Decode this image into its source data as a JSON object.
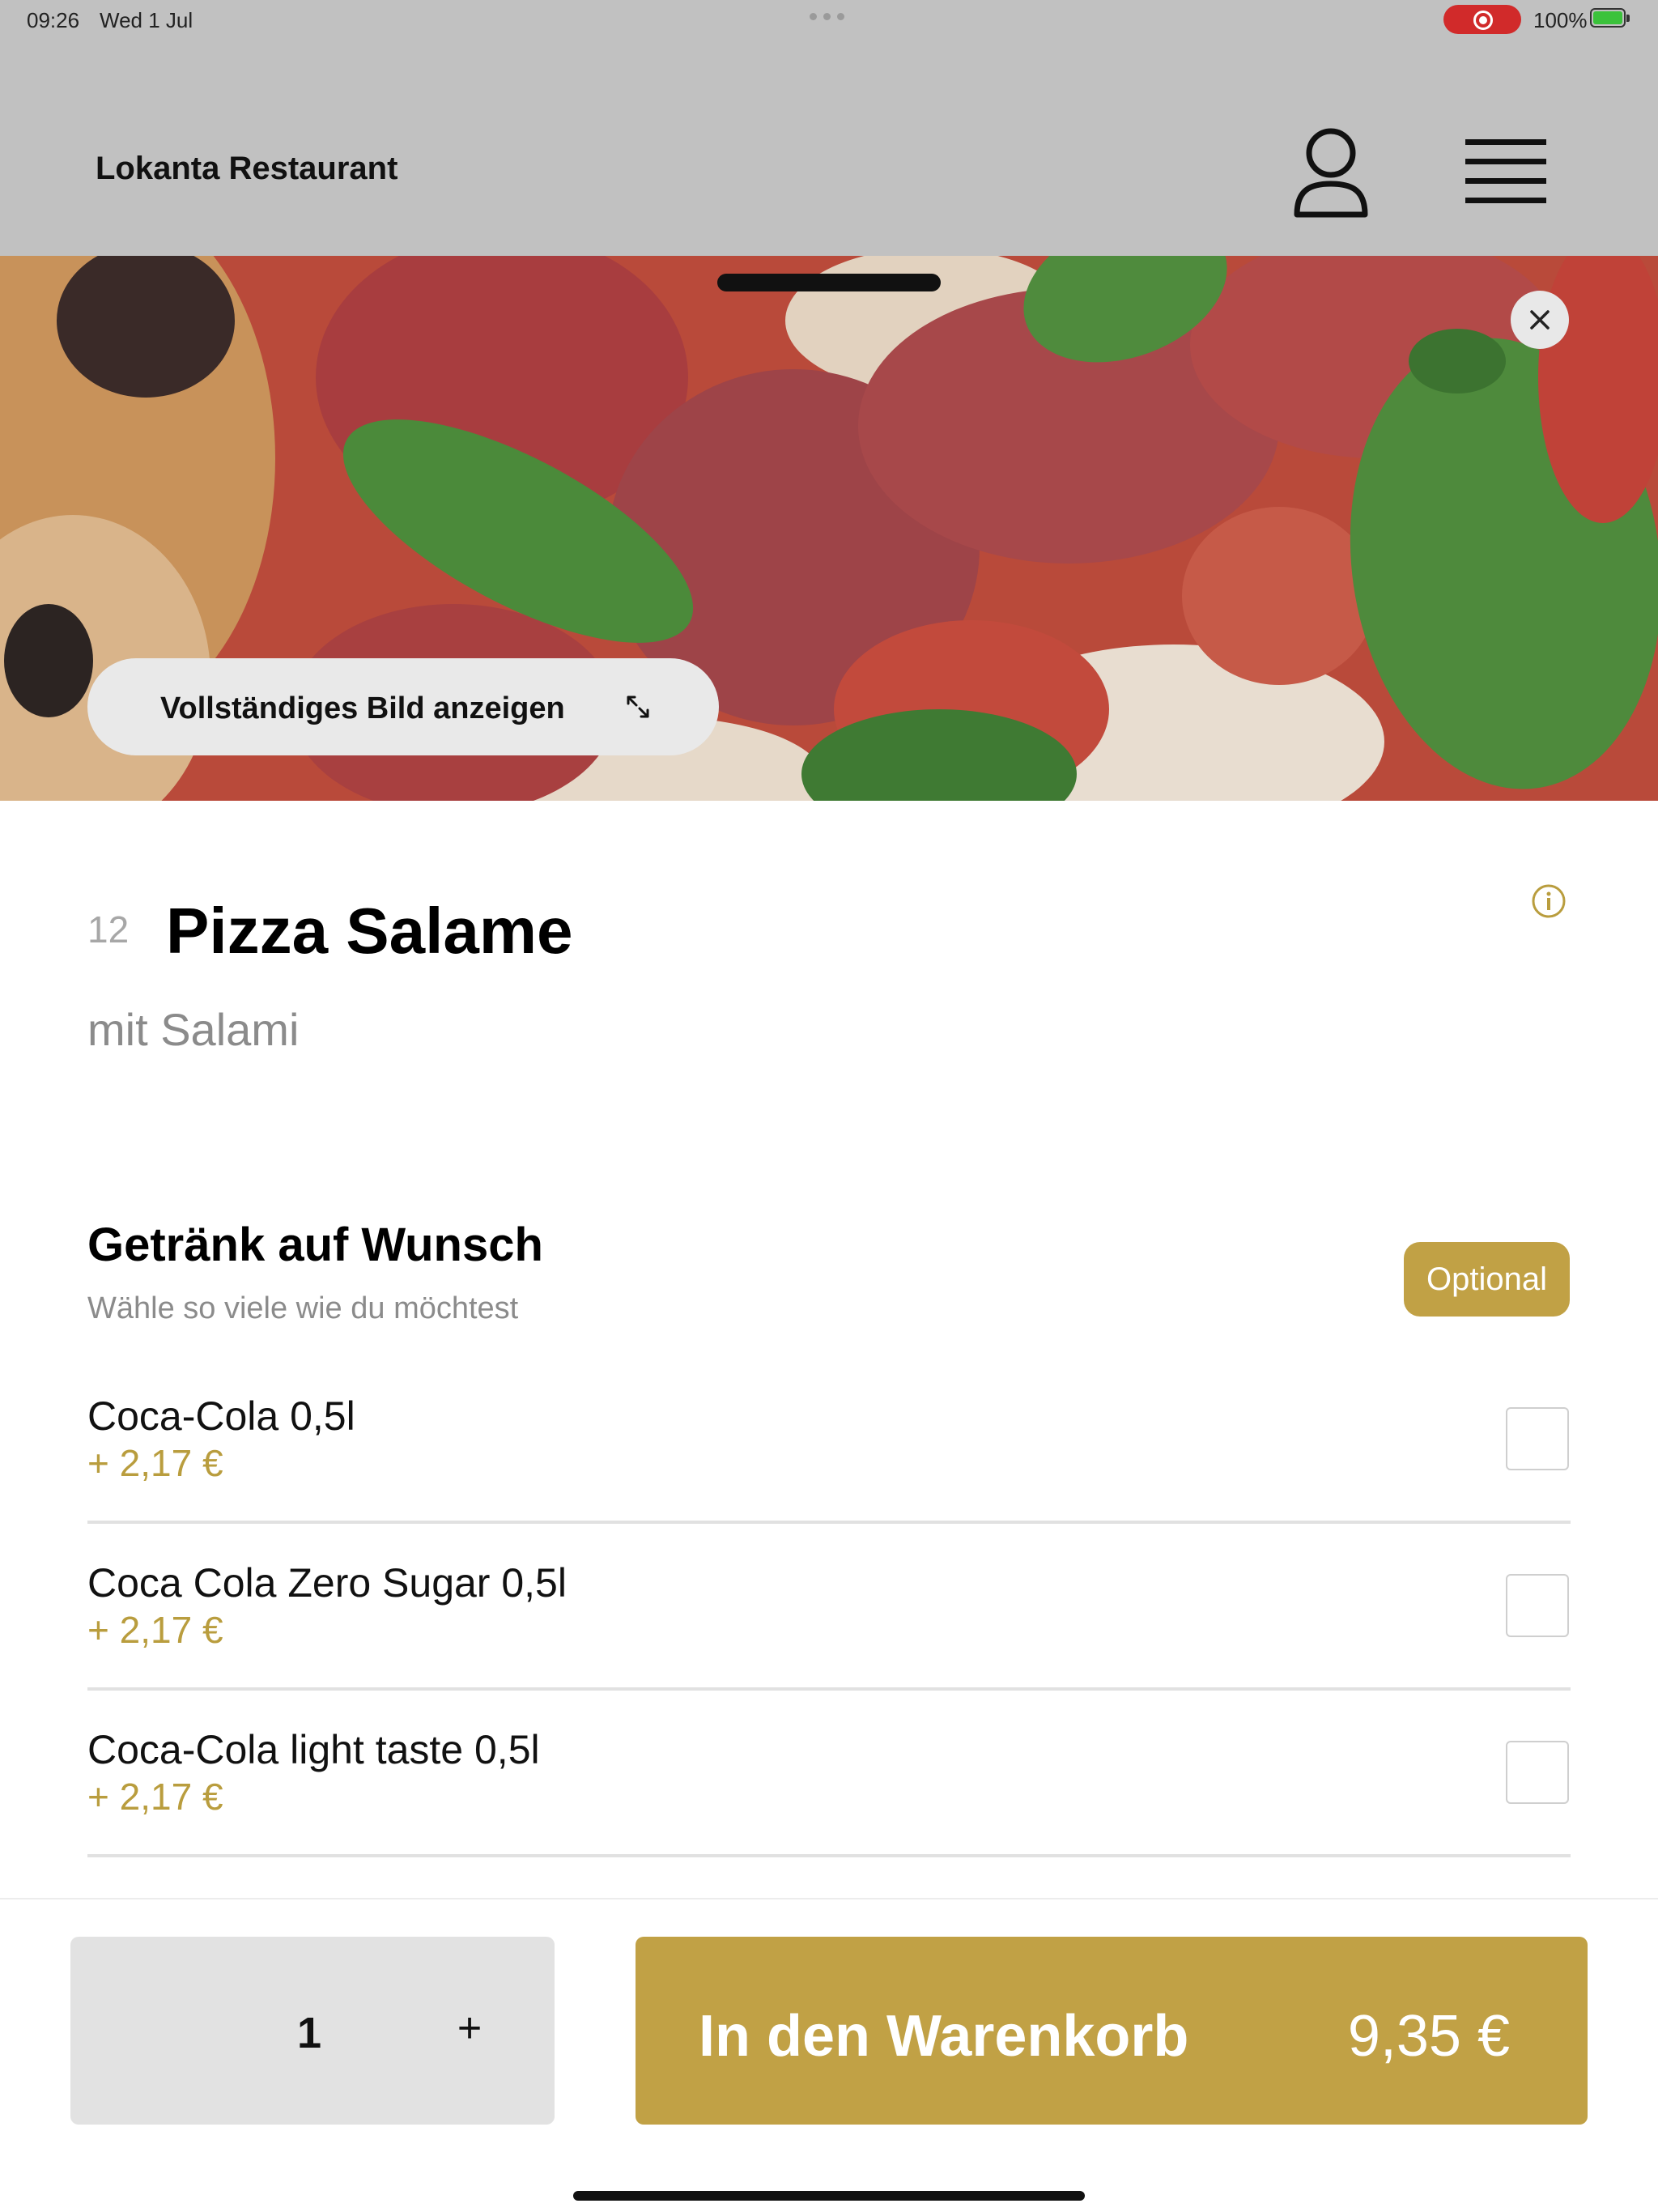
{
  "status_bar": {
    "time": "09:26",
    "date": "Wed 1 Jul",
    "battery_pct": "100%"
  },
  "header": {
    "brand": "Lokanta Restaurant",
    "user_icon": "user-icon",
    "menu_icon": "hamburger-menu-icon"
  },
  "hero": {
    "full_image_label": "Vollständiges Bild anzeigen",
    "expand_icon": "expand-arrows-icon",
    "close_icon": "close-icon"
  },
  "product": {
    "number": "12",
    "title": "Pizza Salame",
    "description": "mit Salami",
    "info_icon": "info-icon"
  },
  "option_group": {
    "title": "Getränk auf Wunsch",
    "hint": "Wähle so viele wie du möchtest",
    "badge": "Optional",
    "options": [
      {
        "name": "Coca-Cola 0,5l",
        "price": "+ 2,17 €",
        "checked": false
      },
      {
        "name": "Coca Cola Zero Sugar 0,5l",
        "price": "+ 2,17 €",
        "checked": false
      },
      {
        "name": "Coca-Cola light taste 0,5l",
        "price": "+ 2,17 €",
        "checked": false
      }
    ]
  },
  "footer": {
    "quantity": "1",
    "plus_label": "+",
    "cart_label": "In den Warenkorb",
    "total": "9,35 €"
  },
  "colors": {
    "accent": "#c1a145",
    "price": "#b99d3e",
    "muted_text": "#8b8b8b",
    "dim_background": "#c1c1c1"
  }
}
